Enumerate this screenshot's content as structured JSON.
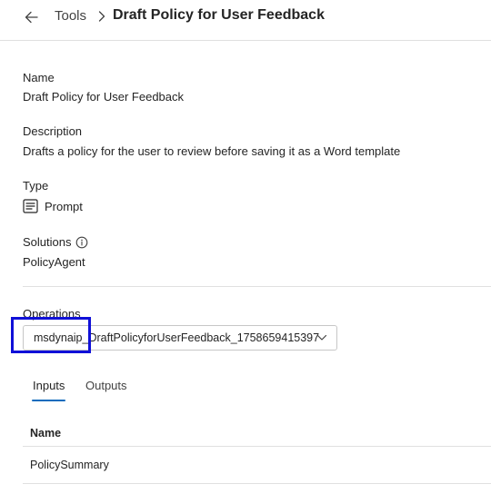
{
  "breadcrumb": {
    "back_icon": "arrow-left-icon",
    "parent": "Tools",
    "separator_icon": "chevron-right-icon",
    "current": "Draft Policy for User Feedback"
  },
  "details": {
    "name_label": "Name",
    "name_value": "Draft Policy for User Feedback",
    "description_label": "Description",
    "description_value": "Drafts a policy for the user to review before saving it as a Word template",
    "type_label": "Type",
    "type_icon": "prompt-icon",
    "type_value": "Prompt",
    "solutions_label": "Solutions",
    "solutions_info_icon": "info-icon",
    "solutions_value": "PolicyAgent"
  },
  "operations": {
    "label": "Operations",
    "selected": "msdynaip_DraftPolicyforUserFeedback_1758659415397",
    "chevron_icon": "chevron-down-icon"
  },
  "tabs": [
    {
      "label": "Inputs",
      "active": true
    },
    {
      "label": "Outputs",
      "active": false
    }
  ],
  "table": {
    "columns": [
      "Name"
    ],
    "rows": [
      [
        "PolicySummary"
      ]
    ]
  },
  "colors": {
    "accent": "#0f6cbd",
    "highlight": "#1010d8"
  }
}
